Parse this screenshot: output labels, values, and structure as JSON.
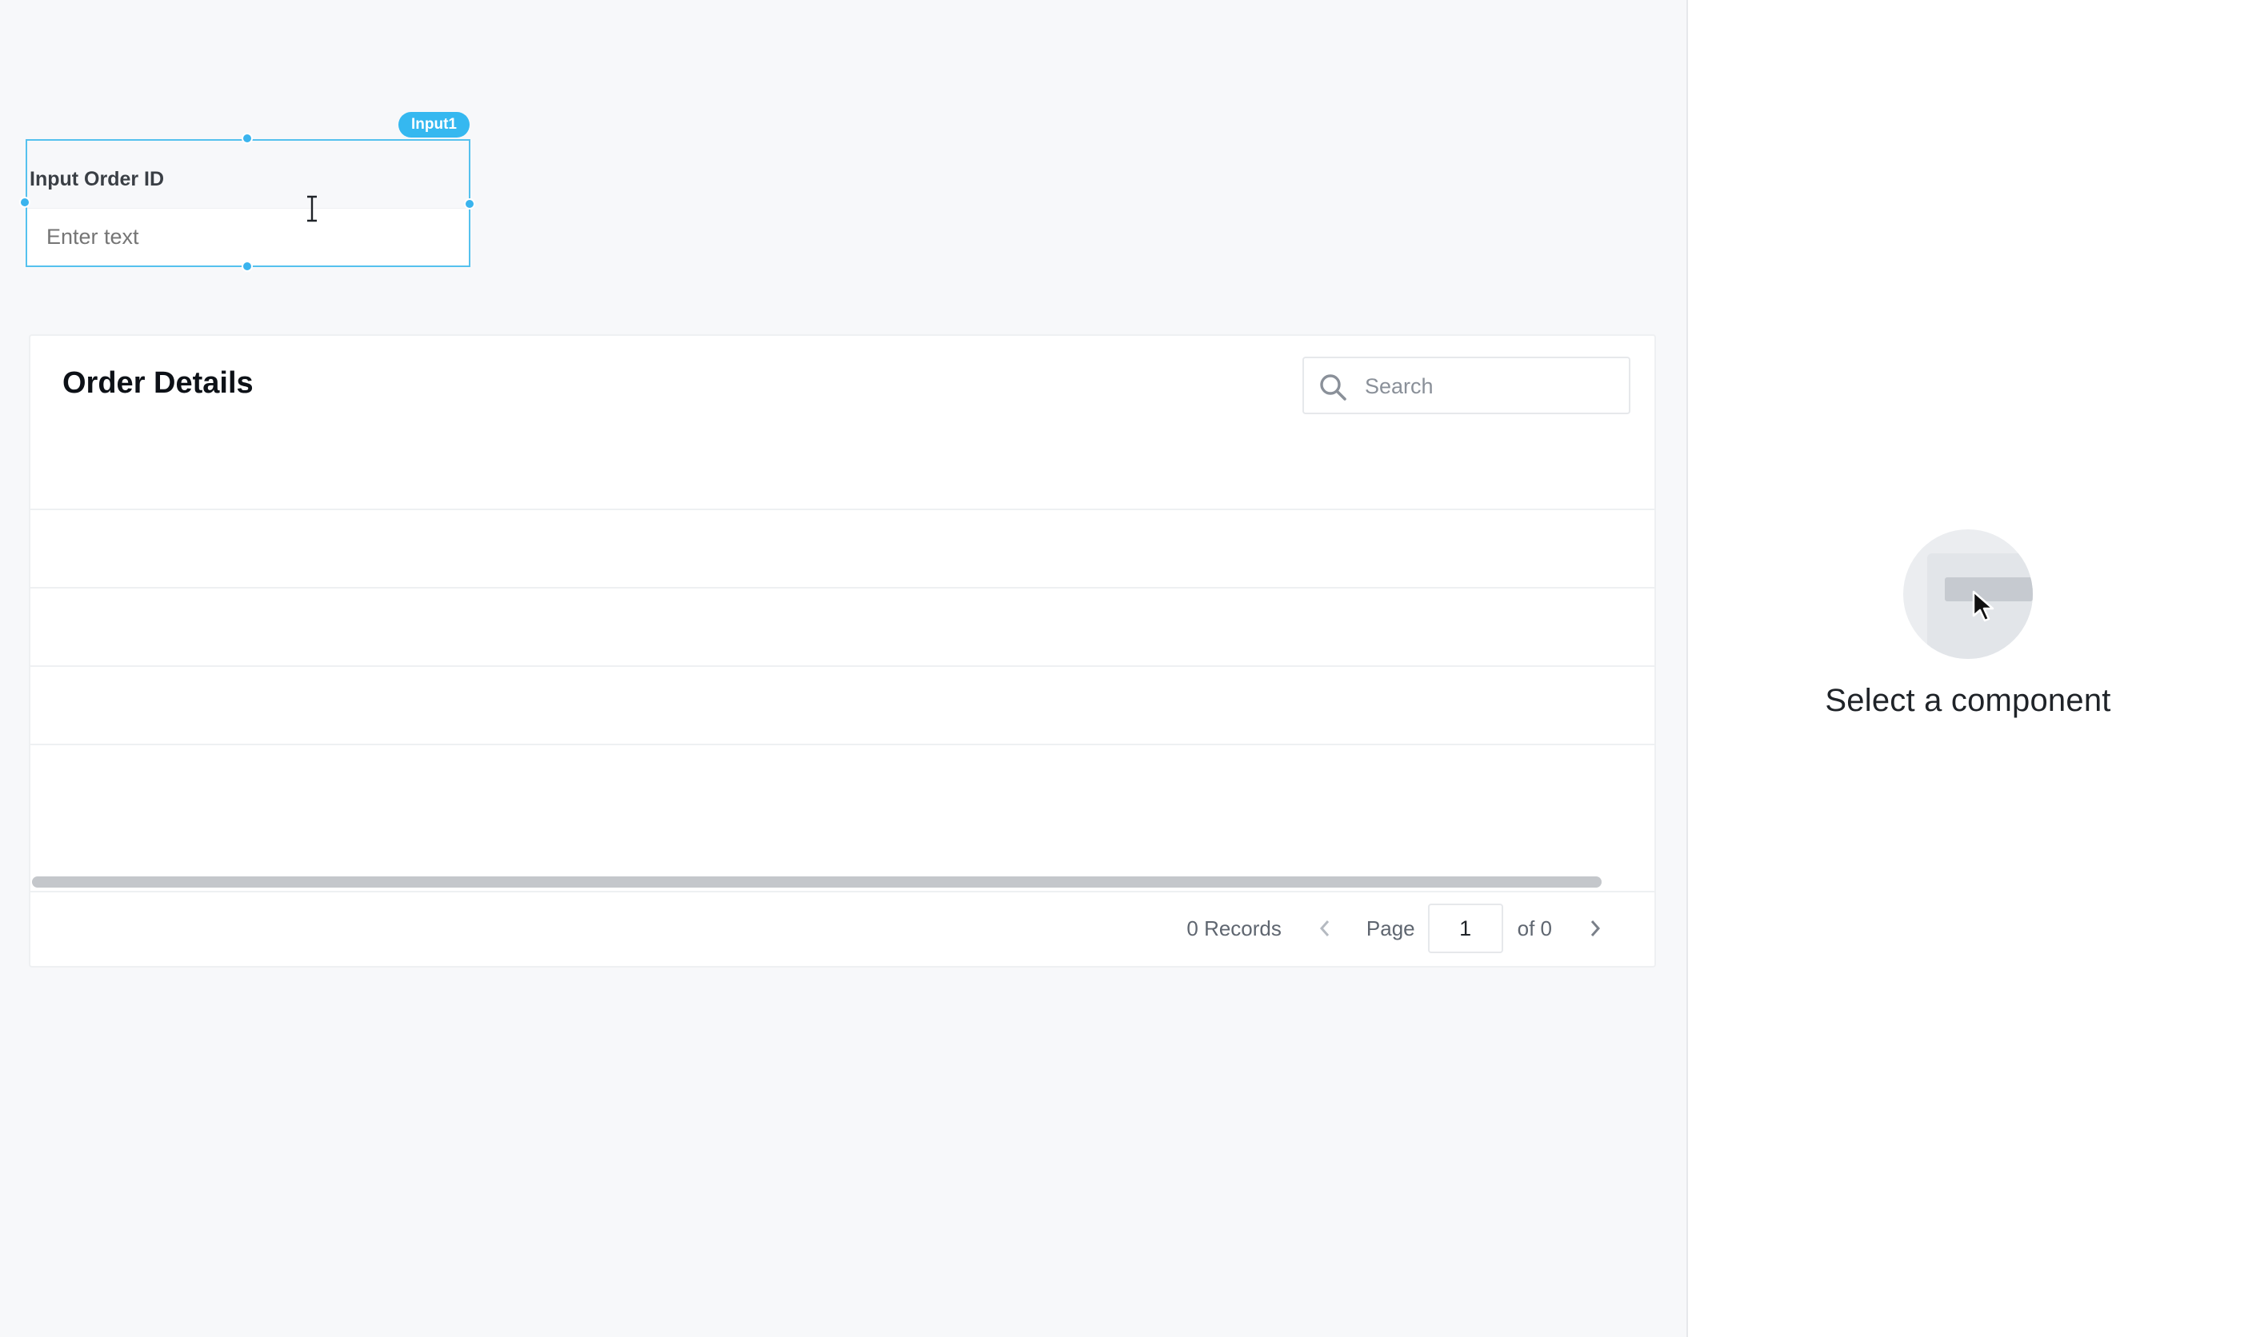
{
  "canvas": {
    "input_widget": {
      "badge": "Input1",
      "label": "Input Order ID",
      "placeholder": "Enter text",
      "value": ""
    },
    "table_widget": {
      "title": "Order Details",
      "search_placeholder": "Search",
      "rows": [],
      "pagination": {
        "records": "0 Records",
        "page_label": "Page",
        "current_page": "1",
        "of_label": "of 0"
      }
    }
  },
  "property_pane": {
    "empty_title": "Select a component"
  },
  "colors": {
    "selection": "#3ab4ee",
    "badge": "#35b8f0"
  },
  "icons": {
    "search": "magnifier",
    "prev": "chevron-left",
    "next": "chevron-right",
    "empty": "component-cursor-illustration"
  }
}
